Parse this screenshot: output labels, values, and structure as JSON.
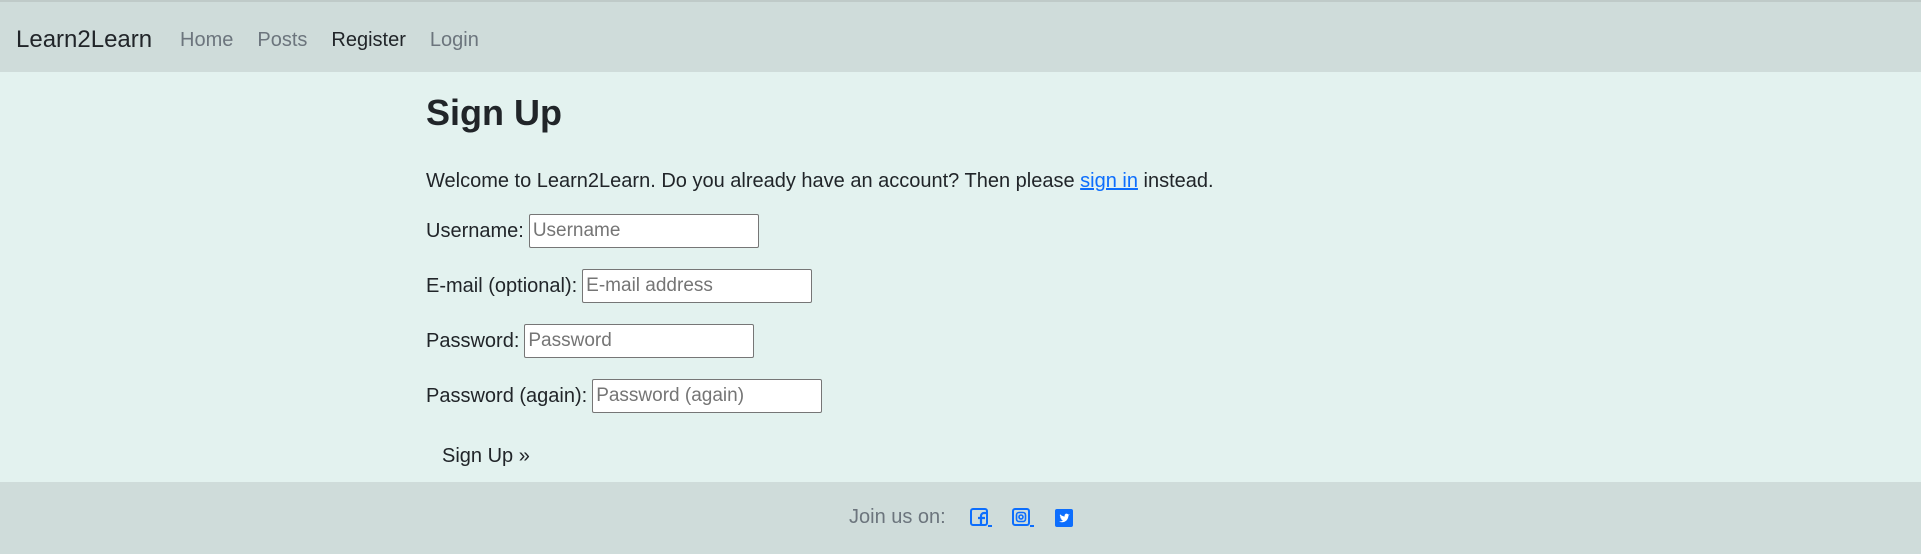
{
  "navbar": {
    "brand": "Learn2Learn",
    "links": [
      {
        "label": "Home",
        "active": false
      },
      {
        "label": "Posts",
        "active": false
      },
      {
        "label": "Register",
        "active": true
      },
      {
        "label": "Login",
        "active": false
      }
    ]
  },
  "signup": {
    "title": "Sign Up",
    "intro_before": "Welcome to Learn2Learn. Do you already have an account? Then please ",
    "intro_link": "sign in",
    "intro_after": " instead.",
    "fields": {
      "username": {
        "label": "Username:",
        "placeholder": "Username",
        "value": ""
      },
      "email": {
        "label": "E-mail (optional):",
        "placeholder": "E-mail address",
        "value": ""
      },
      "password": {
        "label": "Password:",
        "placeholder": "Password",
        "value": ""
      },
      "password2": {
        "label": "Password (again):",
        "placeholder": "Password (again)",
        "value": ""
      }
    },
    "submit_label": "Sign Up »"
  },
  "footer": {
    "text": "Join us on:",
    "social": [
      {
        "icon": "facebook-icon"
      },
      {
        "icon": "instagram-icon"
      },
      {
        "icon": "twitter-icon"
      }
    ]
  },
  "colors": {
    "page_bg": "#e3f2ef",
    "bar_bg": "#cfdcda",
    "link": "#0d6efd",
    "muted": "#6c757d"
  }
}
